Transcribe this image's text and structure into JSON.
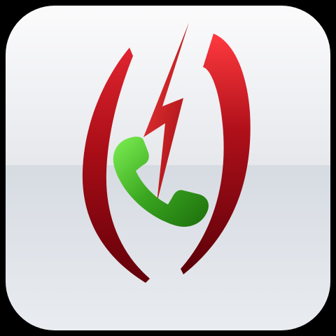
{
  "icon": {
    "name": "call-alert-app-icon",
    "glyphs": [
      "bracket-left-icon",
      "bracket-right-icon",
      "lightning-bolt-icon",
      "phone-handset-icon"
    ]
  },
  "colors": {
    "background": "#000000",
    "tile_top": "#f4f5f7",
    "tile_bottom": "#d9dee4",
    "bracket_light": "#e0202a",
    "bracket_dark": "#6a0008",
    "bolt": "#d8141c",
    "handset_light": "#6fe04a",
    "handset_dark": "#1f7a10"
  }
}
